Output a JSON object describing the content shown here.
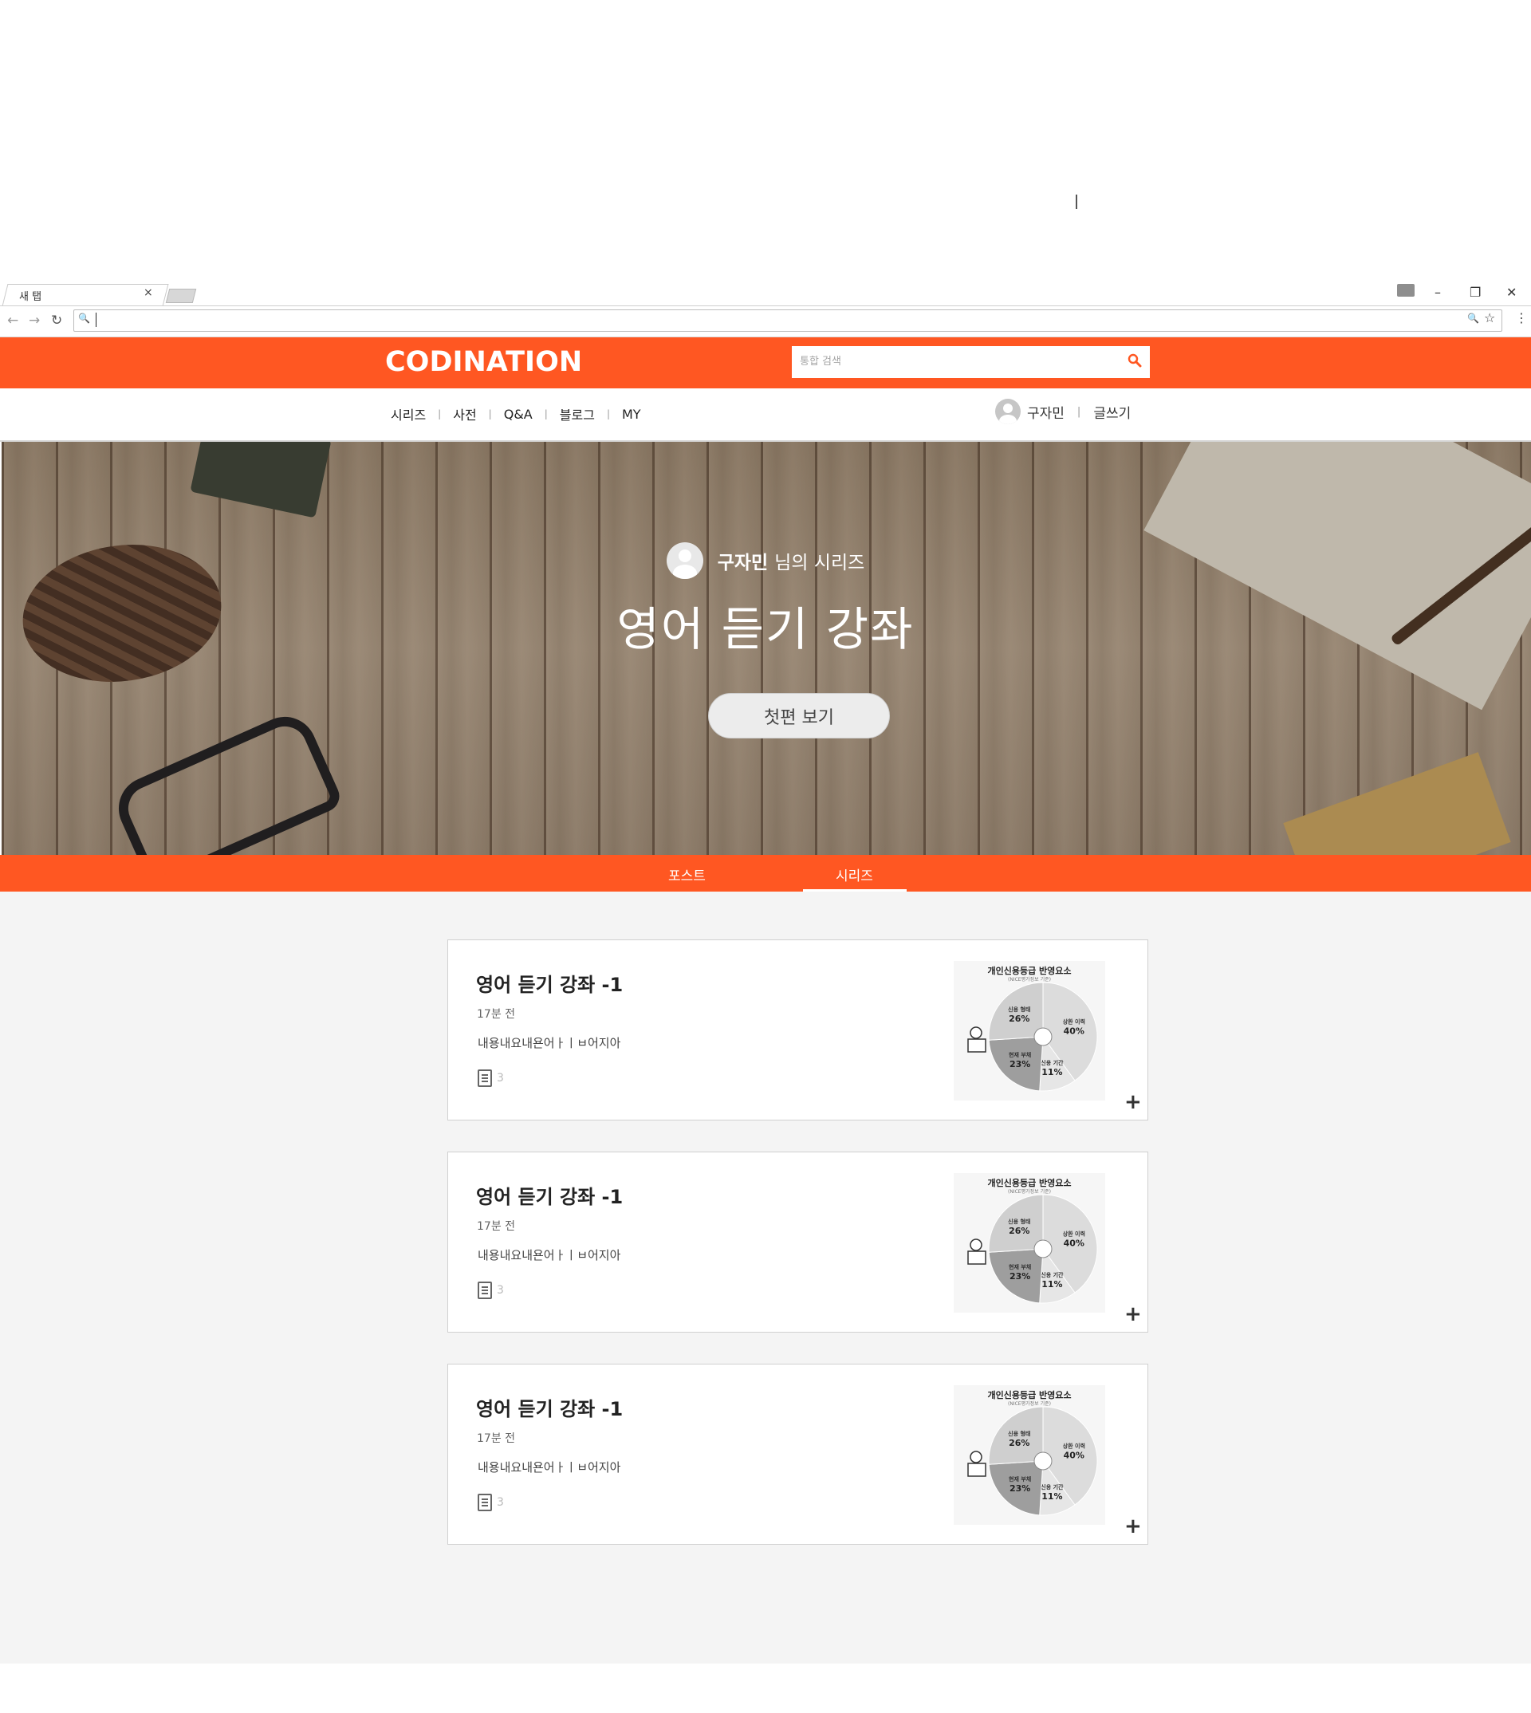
{
  "browser": {
    "tab_title": "새 탭",
    "tab_close": "×",
    "minimize": "–",
    "restore": "❐",
    "close": "✕",
    "back": "←",
    "forward": "→",
    "reload": "↻",
    "zoom_icon": "🔍",
    "star_icon": "☆",
    "menu_icon": "⋮"
  },
  "site": {
    "logo": "CODINATION",
    "search_placeholder": "통합 검색",
    "accent_color": "#ff5722"
  },
  "nav": {
    "items": [
      "시리즈",
      "사전",
      "Q&A",
      "블로그",
      "MY"
    ],
    "separator": "|"
  },
  "user": {
    "name": "구자민",
    "write": "글쓰기",
    "separator": "|"
  },
  "hero": {
    "author": "구자민",
    "author_suffix": "님의 시리즈",
    "title": "영어 듣기 강좌",
    "button": "첫편 보기"
  },
  "tabs": {
    "posts": "포스트",
    "series": "시리즈",
    "active": "시리즈"
  },
  "cards": [
    {
      "title": "영어 듣기 강좌 -1",
      "time": "17분 전",
      "body": "내용내요내욘어ㅏㅣㅂ어지아",
      "count": "3",
      "thumb_title": "개인신용등급 반영요소",
      "thumb_subtitle": "(NICE평가정보 기준)",
      "thumb_slices": [
        {
          "label": "상환 이력",
          "value": 40
        },
        {
          "label": "신용 형태",
          "value": 26
        },
        {
          "label": "현재 부채",
          "value": 23
        },
        {
          "label": "신용 기간",
          "value": 11
        }
      ]
    },
    {
      "title": "영어 듣기 강좌 -1",
      "time": "17분 전",
      "body": "내용내요내욘어ㅏㅣㅂ어지아",
      "count": "3",
      "thumb_title": "개인신용등급 반영요소",
      "thumb_subtitle": "(NICE평가정보 기준)",
      "thumb_slices": [
        {
          "label": "상환 이력",
          "value": 40
        },
        {
          "label": "신용 형태",
          "value": 26
        },
        {
          "label": "현재 부채",
          "value": 23
        },
        {
          "label": "신용 기간",
          "value": 11
        }
      ]
    },
    {
      "title": "영어 듣기 강좌 -1",
      "time": "17분 전",
      "body": "내용내요내욘어ㅏㅣㅂ어지아",
      "count": "3",
      "thumb_title": "개인신용등급 반영요소",
      "thumb_subtitle": "(NICE평가정보 기준)",
      "thumb_slices": [
        {
          "label": "상환 이력",
          "value": 40
        },
        {
          "label": "신용 형태",
          "value": 26
        },
        {
          "label": "현재 부채",
          "value": 23
        },
        {
          "label": "신용 기간",
          "value": 11
        }
      ]
    }
  ],
  "plus_icon": "+"
}
